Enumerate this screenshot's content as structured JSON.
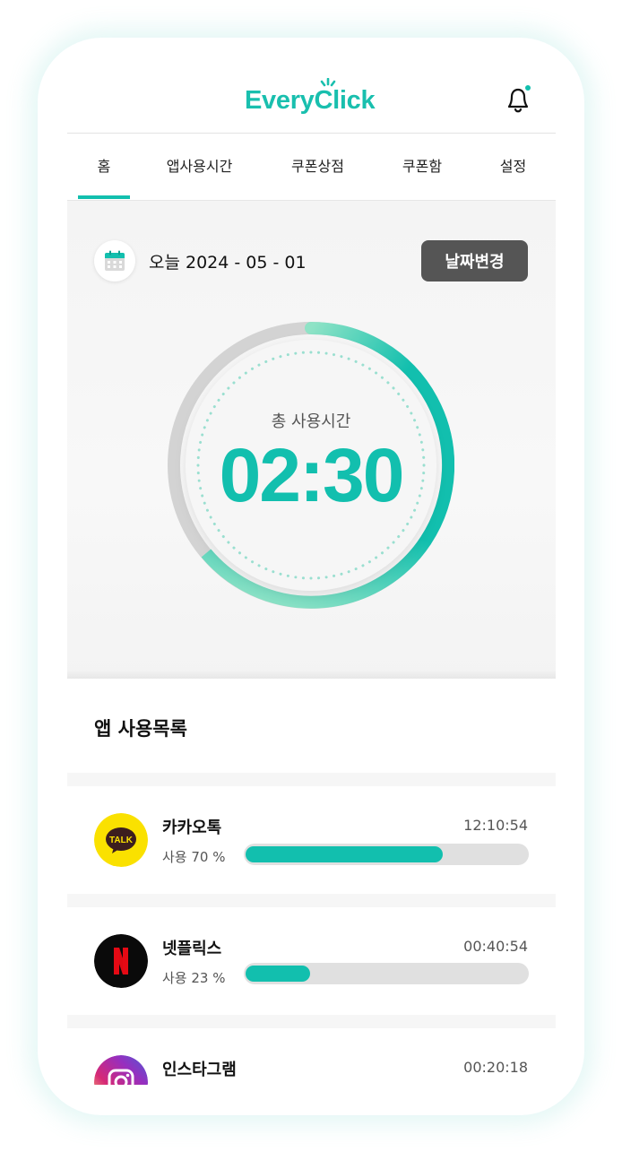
{
  "header": {
    "logo_text": "EveryClick",
    "notification_icon": "bell-icon"
  },
  "tabs": [
    {
      "label": "홈",
      "active": true
    },
    {
      "label": "앱사용시간",
      "active": false
    },
    {
      "label": "쿠폰상점",
      "active": false
    },
    {
      "label": "쿠폰함",
      "active": false
    },
    {
      "label": "설정",
      "active": false
    }
  ],
  "today": {
    "date_text": "오늘 2024 - 05 - 01",
    "change_date_label": "날짜변경",
    "total_label": "총 사용시간",
    "total_time": "02:30",
    "calendar_icon": "calendar-icon"
  },
  "app_list": {
    "title": "앱 사용목록",
    "apps": [
      {
        "name": "카카오톡",
        "time": "12:10:54",
        "usage_label": "사용 70 %",
        "usage_pct": 70,
        "icon": "kakaotalk-icon",
        "icon_text": "TALK"
      },
      {
        "name": "넷플릭스",
        "time": "00:40:54",
        "usage_label": "사용 23 %",
        "usage_pct": 23,
        "icon": "netflix-icon",
        "icon_text": "N"
      },
      {
        "name": "인스타그램",
        "time": "00:20:18",
        "icon": "instagram-icon"
      }
    ]
  },
  "colors": {
    "accent": "#12bfae",
    "accent_light": "#8fe3c6",
    "track": "#d3d3d3",
    "button_dark": "#555555"
  }
}
